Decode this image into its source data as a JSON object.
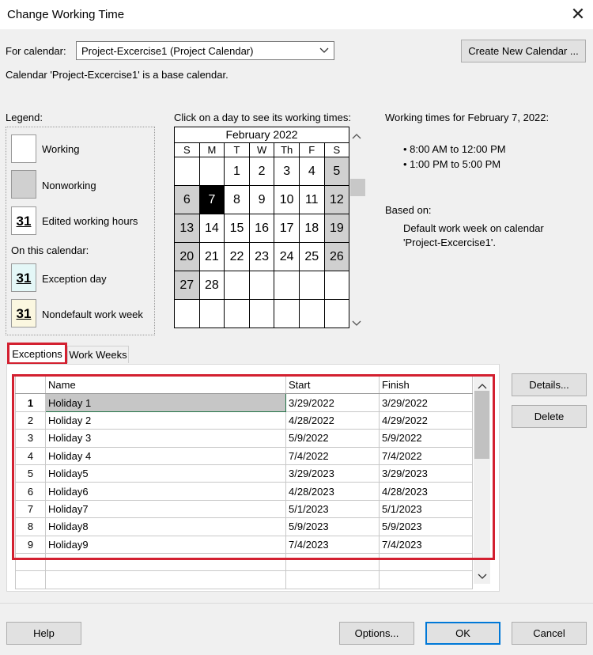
{
  "dialog": {
    "title": "Change Working Time",
    "close_glyph": "✕"
  },
  "calendar_selector": {
    "label": "For calendar:",
    "value": "Project-Excercise1 (Project Calendar)",
    "create_button": "Create New Calendar ...",
    "note": "Calendar 'Project-Excercise1' is a base calendar."
  },
  "legend": {
    "title": "Legend:",
    "working": "Working",
    "nonworking": "Nonworking",
    "edited": "Edited working hours",
    "sample_day": "31",
    "on_this_calendar": "On this calendar:",
    "exception": "Exception day",
    "nondefault": "Nondefault work week"
  },
  "calendar": {
    "prompt": "Click on a day to see its working times:",
    "month": "February 2022",
    "weekdays": [
      "S",
      "M",
      "T",
      "W",
      "Th",
      "F",
      "S"
    ],
    "weeks": [
      [
        "",
        "",
        "1",
        "2",
        "3",
        "4",
        "5"
      ],
      [
        "6",
        "7",
        "8",
        "9",
        "10",
        "11",
        "12"
      ],
      [
        "13",
        "14",
        "15",
        "16",
        "17",
        "18",
        "19"
      ],
      [
        "20",
        "21",
        "22",
        "23",
        "24",
        "25",
        "26"
      ],
      [
        "27",
        "28",
        "",
        "",
        "",
        "",
        ""
      ],
      [
        "",
        "",
        "",
        "",
        "",
        "",
        ""
      ]
    ],
    "selected_day": "7"
  },
  "working_times": {
    "heading": "Working times for February 7, 2022:",
    "times": [
      "8:00 AM to 12:00 PM",
      "1:00 PM to 5:00 PM"
    ],
    "based_on_label": "Based on:",
    "based_on_text": "Default work week on calendar 'Project-Excercise1'."
  },
  "tabs": {
    "exceptions": "Exceptions",
    "work_weeks": "Work Weeks"
  },
  "grid": {
    "headers": {
      "name": "Name",
      "start": "Start",
      "finish": "Finish"
    },
    "rows": [
      {
        "n": "1",
        "name": "Holiday 1",
        "start": "3/29/2022",
        "finish": "3/29/2022"
      },
      {
        "n": "2",
        "name": "Holiday 2",
        "start": "4/28/2022",
        "finish": "4/29/2022"
      },
      {
        "n": "3",
        "name": "Holiday 3",
        "start": "5/9/2022",
        "finish": "5/9/2022"
      },
      {
        "n": "4",
        "name": "Holiday 4",
        "start": "7/4/2022",
        "finish": "7/4/2022"
      },
      {
        "n": "5",
        "name": "Holiday5",
        "start": "3/29/2023",
        "finish": "3/29/2023"
      },
      {
        "n": "6",
        "name": "Holiday6",
        "start": "4/28/2023",
        "finish": "4/28/2023"
      },
      {
        "n": "7",
        "name": "Holiday7",
        "start": "5/1/2023",
        "finish": "5/1/2023"
      },
      {
        "n": "8",
        "name": "Holiday8",
        "start": "5/9/2023",
        "finish": "5/9/2023"
      },
      {
        "n": "9",
        "name": "Holiday9",
        "start": "7/4/2023",
        "finish": "7/4/2023"
      }
    ]
  },
  "side_buttons": {
    "details": "Details...",
    "delete": "Delete"
  },
  "footer": {
    "help": "Help",
    "options": "Options...",
    "ok": "OK",
    "cancel": "Cancel"
  },
  "colors": {
    "highlight": "#d32030",
    "nonworking": "#d0d0d0",
    "selected_day": "#000000"
  }
}
